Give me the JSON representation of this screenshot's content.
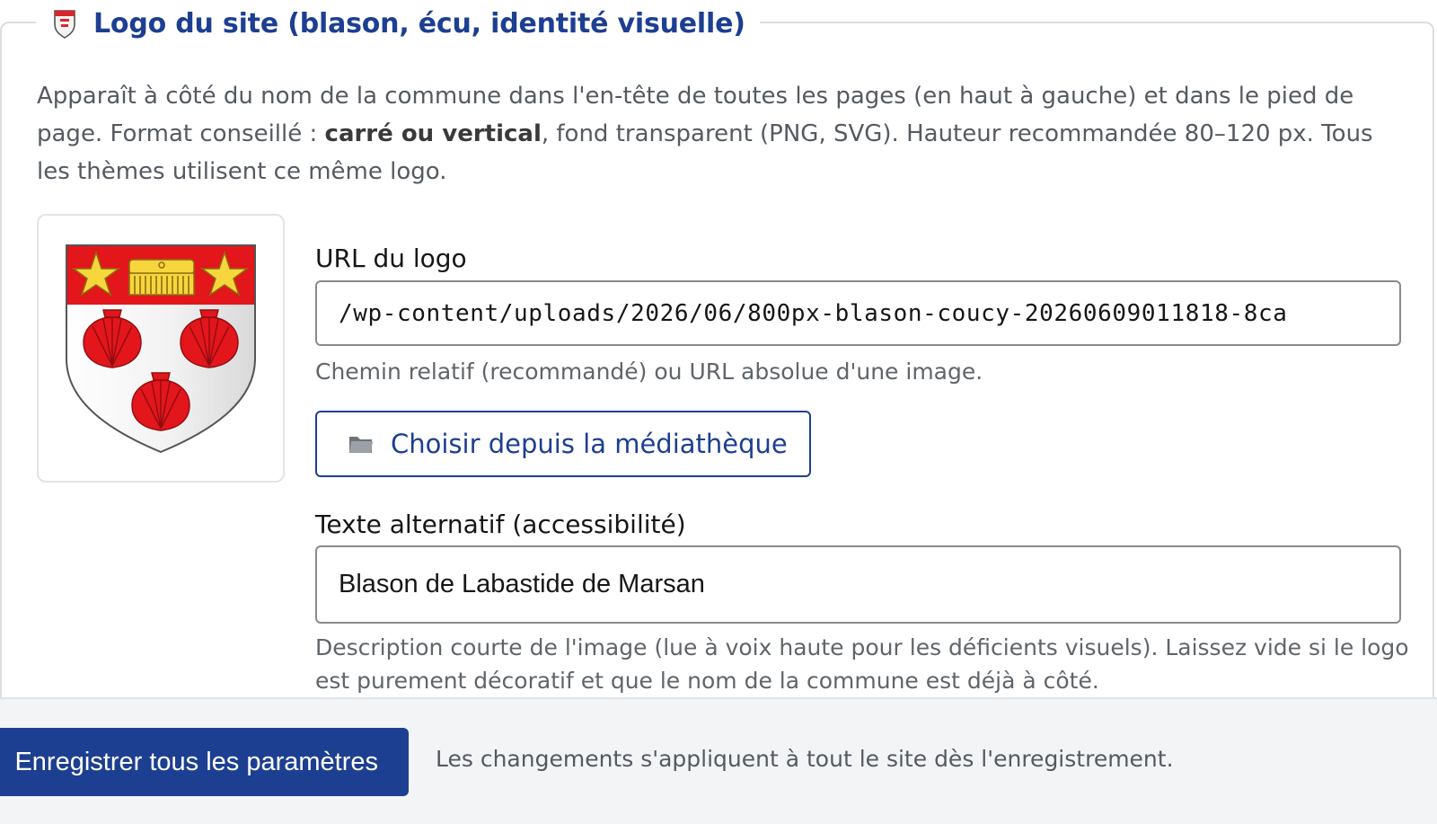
{
  "section": {
    "legend_icon": "shield-icon",
    "title": "Logo du site (blason, écu, identité visuelle)",
    "help_part1": "Apparaît à côté du nom de la commune dans l'en-tête de toutes les pages (en haut à gauche) et dans le pied de page. Format conseillé : ",
    "help_bold": "carré ou vertical",
    "help_part2": ", fond transparent (PNG, SVG). Hauteur recommandée 80–120 px. Tous les thèmes utilisent ce même logo."
  },
  "preview": {
    "image_icon": "coat-of-arms-icon"
  },
  "logo_url": {
    "label": "URL du logo",
    "value": "/wp-content/uploads/2026/06/800px-blason-coucy-20260609011818-8ca",
    "hint": "Chemin relatif (recommandé) ou URL absolue d'une image."
  },
  "media_button": {
    "icon": "folder-icon",
    "label": "Choisir depuis la médiathèque"
  },
  "alt_text": {
    "label": "Texte alternatif (accessibilité)",
    "value": "Blason de Labastide de Marsan",
    "hint": "Description courte de l'image (lue à voix haute pour les déficients visuels). Laissez vide si le logo est purement décoratif et que le nom de la commune est déjà à côté."
  },
  "footer": {
    "save_label": "Enregistrer tous les paramètres",
    "note": "Les changements s'appliquent à tout le site dès l'enregistrement."
  },
  "colors": {
    "primary": "#1d3f91",
    "shield_red": "#e2161b",
    "star_yellow": "#f7d53d"
  }
}
